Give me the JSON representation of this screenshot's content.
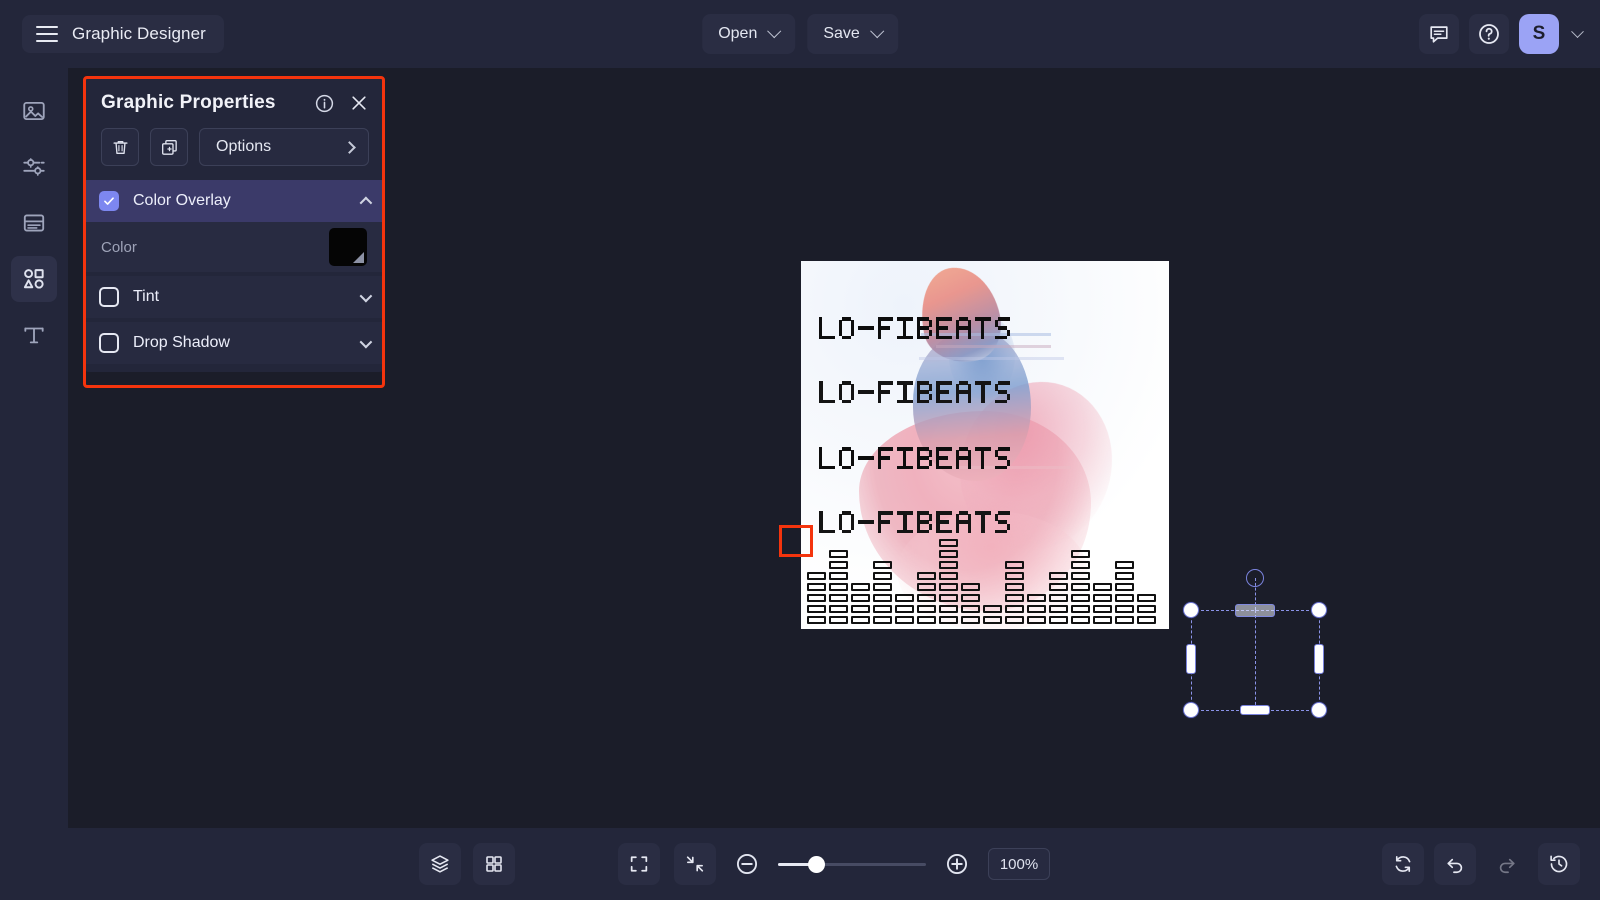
{
  "app": {
    "title": "Graphic Designer",
    "menu_icon": "hamburger-icon"
  },
  "topbar": {
    "open_label": "Open",
    "save_label": "Save",
    "comment_icon": "comment-icon",
    "help_icon": "help-circle-icon",
    "avatar_initial": "S",
    "account_caret": "chevron-down-icon"
  },
  "rail": {
    "items": [
      {
        "name": "image",
        "icon": "image-icon",
        "active": false
      },
      {
        "name": "adjustments",
        "icon": "sliders-icon",
        "active": false
      },
      {
        "name": "layout",
        "icon": "layout-block-icon",
        "active": false
      },
      {
        "name": "shapes",
        "icon": "shapes-icon",
        "active": true
      },
      {
        "name": "text",
        "icon": "text-type-icon",
        "active": false
      }
    ]
  },
  "panel": {
    "title": "Graphic Properties",
    "info_icon": "info-circle-icon",
    "close_icon": "close-icon",
    "delete_icon": "trash-icon",
    "duplicate_icon": "duplicate-icon",
    "options_label": "Options",
    "options_chevron": "chevron-right-icon",
    "sections": [
      {
        "label": "Color Overlay",
        "checked": true,
        "expanded": true,
        "chevron": "chevron-up-icon"
      },
      {
        "label": "Tint",
        "checked": false,
        "expanded": false,
        "chevron": "chevron-down-icon"
      },
      {
        "label": "Drop Shadow",
        "checked": false,
        "expanded": false,
        "chevron": "chevron-down-icon"
      }
    ],
    "color_row": {
      "label": "Color",
      "swatch_hex": "#000000"
    },
    "highlight_color": "#f4340d"
  },
  "canvas": {
    "artwork_lines": [
      {
        "text": "LO-FI BEATS",
        "style": "solid"
      },
      {
        "text": "LO-FI BEATS",
        "style": "outline"
      },
      {
        "text": "LO-FI BEATS",
        "style": "solid"
      },
      {
        "text": "LO-FI BEATS",
        "style": "outline"
      }
    ],
    "background": "#ffffff",
    "selection": {
      "handle_color": "#ffffff",
      "outline_color": "#8b93e8",
      "highlighted_handle": "top-left"
    }
  },
  "bottombar": {
    "layers_icon": "layers-icon",
    "grid_icon": "grid-icon",
    "fit_screen_icon": "fit-screen-icon",
    "shrink_icon": "collapse-arrows-icon",
    "zoom_out_icon": "zoom-out-icon",
    "zoom_in_icon": "zoom-in-icon",
    "zoom_value": "100%",
    "reset_icon": "reset-rotate-icon",
    "undo_icon": "undo-icon",
    "redo_icon": "redo-icon",
    "history_icon": "history-clock-icon"
  }
}
